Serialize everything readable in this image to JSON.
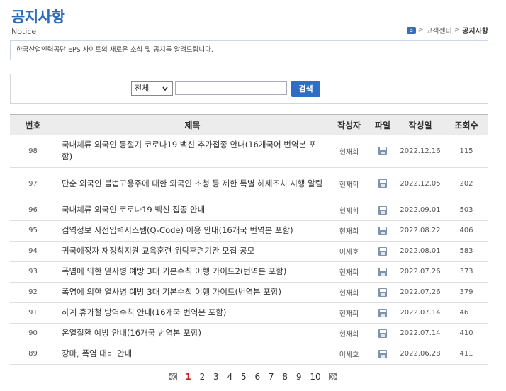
{
  "page": {
    "title": "공지사항",
    "subtitle": "Notice",
    "intro": "한국산업인력공단 EPS 사이트의 새로운 소식 및 공지를 알려드립니다."
  },
  "breadcrumb": {
    "home_icon": "home-icon",
    "section": "고객센터",
    "current": "공지사항",
    "separator": ">"
  },
  "search": {
    "scope_selected": "전체",
    "query_value": "",
    "button_label": "검색"
  },
  "table": {
    "headers": [
      "번호",
      "제목",
      "작성자",
      "파일",
      "작성일",
      "조회수"
    ],
    "rows": [
      {
        "no": "98",
        "title": "국내체류 외국인 동절기 코로나19 백신 추가접종 안내(16개국어 번역본 포함)",
        "author": "현재희",
        "file_icon": "file-icon",
        "date": "2022.12.16",
        "views": "115"
      },
      {
        "no": "97",
        "title": "단순 외국인 불법고용주에 대한 외국인 초청 등 제한 특별 해제조치 시행 알림",
        "author": "현재희",
        "file_icon": "file-icon",
        "date": "2022.12.05",
        "views": "202"
      },
      {
        "no": "96",
        "title": "국내체류 외국인 코로나19 백신 접종 안내",
        "author": "현재희",
        "file_icon": "file-icon",
        "date": "2022.09.01",
        "views": "503"
      },
      {
        "no": "95",
        "title": "검역정보 사전입력시스템(Q-Code) 이용 안내(16개국 번역본 포함)",
        "author": "현재희",
        "file_icon": "file-icon",
        "date": "2022.08.22",
        "views": "406"
      },
      {
        "no": "94",
        "title": "귀국예정자 재정착지원 교육훈련 위탁훈련기관 모집 공모",
        "author": "이세호",
        "file_icon": "file-icon",
        "date": "2022.08.01",
        "views": "583"
      },
      {
        "no": "93",
        "title": "폭염에 의한 열사병 예방 3대 기본수칙 이행 가이드2(번역본 포함)",
        "author": "현재희",
        "file_icon": "file-icon",
        "date": "2022.07.26",
        "views": "373"
      },
      {
        "no": "92",
        "title": "폭염에 의한 열사병 예방 3대 기본수칙 이행 가이드(번역본 포함)",
        "author": "현재희",
        "file_icon": "file-icon",
        "date": "2022.07.26",
        "views": "379"
      },
      {
        "no": "91",
        "title": "하계 휴가철 방역수칙 안내(16개국 번역본 포함)",
        "author": "현재희",
        "file_icon": "file-icon",
        "date": "2022.07.14",
        "views": "461"
      },
      {
        "no": "90",
        "title": "온열질환 예방 안내(16개국 번역본 포함)",
        "author": "현재희",
        "file_icon": "file-icon",
        "date": "2022.07.14",
        "views": "410"
      },
      {
        "no": "89",
        "title": "장마, 폭염 대비 안내",
        "author": "이세호",
        "file_icon": "file-icon",
        "date": "2022.06.28",
        "views": "411"
      }
    ]
  },
  "pagination": {
    "first_icon": "first-page-icon",
    "last_icon": "last-page-icon",
    "pages": [
      "1",
      "2",
      "3",
      "4",
      "5",
      "6",
      "7",
      "8",
      "9",
      "10"
    ],
    "current": "1"
  },
  "colors": {
    "title_blue": "#2b6cb7",
    "button_blue": "#2e6fc4",
    "active_page_red": "#d11a1a"
  }
}
